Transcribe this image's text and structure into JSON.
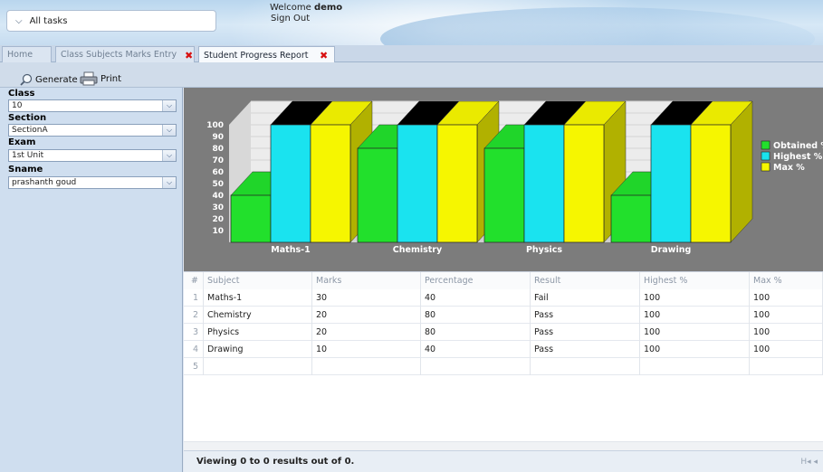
{
  "header": {
    "task_menu_label": "All tasks",
    "welcome_prefix": "Welcome",
    "username": "demo",
    "sign_out_label": "Sign Out"
  },
  "tabs": [
    {
      "label": "Home",
      "closable": false
    },
    {
      "label": "Class Subjects Marks Entry",
      "closable": true
    },
    {
      "label": "Student Progress Report",
      "closable": true,
      "active": true
    }
  ],
  "toolbar": {
    "generate_label": "Generate",
    "print_label": "Print"
  },
  "filters": [
    {
      "label": "Class",
      "value": "10"
    },
    {
      "label": "Section",
      "value": "SectionA"
    },
    {
      "label": "Exam",
      "value": "1st Unit"
    },
    {
      "label": "Sname",
      "value": "prashanth goud"
    }
  ],
  "chart_data": {
    "type": "bar",
    "categories": [
      "Maths-1",
      "Chemistry",
      "Physics",
      "Drawing"
    ],
    "series": [
      {
        "name": "Obtained %",
        "values": [
          40,
          80,
          80,
          40
        ],
        "color": "#22e02c"
      },
      {
        "name": "Highest %",
        "values": [
          100,
          100,
          100,
          100
        ],
        "color": "#1ae3ef"
      },
      {
        "name": "Max %",
        "values": [
          100,
          100,
          100,
          100
        ],
        "color": "#f6f600"
      }
    ],
    "y_ticks": [
      10,
      20,
      30,
      40,
      50,
      60,
      70,
      80,
      90,
      100
    ],
    "ylim": [
      0,
      100
    ],
    "legend_position": "right",
    "background": "#7c7c7c"
  },
  "table": {
    "columns": [
      "#",
      "Subject",
      "Marks",
      "Percentage",
      "Result",
      "Highest %",
      "Max %"
    ],
    "rows": [
      [
        "1",
        "Maths-1",
        "30",
        "40",
        "Fail",
        "100",
        "100"
      ],
      [
        "2",
        "Chemistry",
        "20",
        "80",
        "Pass",
        "100",
        "100"
      ],
      [
        "3",
        "Physics",
        "20",
        "80",
        "Pass",
        "100",
        "100"
      ],
      [
        "4",
        "Drawing",
        "10",
        "40",
        "Pass",
        "100",
        "100"
      ],
      [
        "5",
        "",
        "",
        "",
        "",
        "",
        ""
      ]
    ]
  },
  "footer": {
    "status_text": "Viewing 0 to 0 results out of 0.",
    "pager_symbol": "H◂ ◂"
  }
}
